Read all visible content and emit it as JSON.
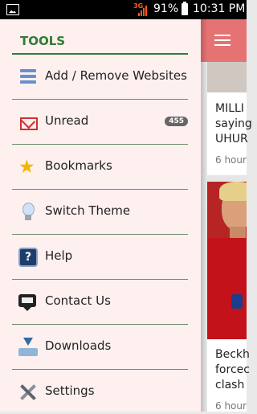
{
  "status_bar": {
    "network": "3G",
    "battery_percent": "91%",
    "time": "10:31 PM"
  },
  "drawer": {
    "title": "TOOLS",
    "items": [
      {
        "label": "Add / Remove Websites",
        "icon": "list-icon"
      },
      {
        "label": "Unread",
        "icon": "mail-icon",
        "badge": "455"
      },
      {
        "label": "Bookmarks",
        "icon": "star-icon"
      },
      {
        "label": "Switch Theme",
        "icon": "bulb-icon"
      },
      {
        "label": "Help",
        "icon": "help-icon"
      },
      {
        "label": "Contact Us",
        "icon": "chat-icon"
      },
      {
        "label": "Downloads",
        "icon": "download-icon"
      },
      {
        "label": "Settings",
        "icon": "tools-icon"
      }
    ]
  },
  "articles": [
    {
      "title_lines": [
        "MILLI",
        "saying",
        "UHUR"
      ],
      "time": "6 hour"
    },
    {
      "title_lines": [
        "Beckh",
        "forcec",
        "clash"
      ],
      "time": "6 hour"
    }
  ],
  "colors": {
    "accent": "#e57373",
    "tools_green": "#2e7d32",
    "drawer_bg": "#fff0f0"
  }
}
